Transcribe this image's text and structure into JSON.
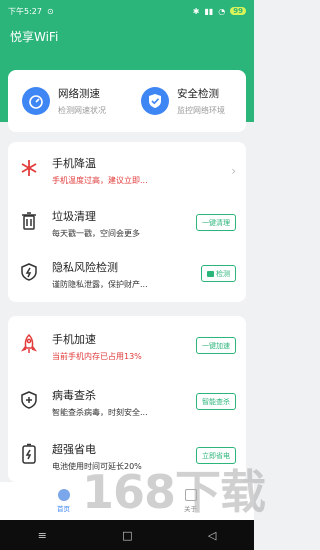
{
  "status_bar": {
    "time": "下午5:27",
    "battery": "99"
  },
  "app": {
    "title": "悦享WiFi"
  },
  "quick_actions": [
    {
      "title": "网络测速",
      "subtitle": "检测网速状况",
      "icon": "speedometer-icon"
    },
    {
      "title": "安全检测",
      "subtitle": "监控网络环境",
      "icon": "shield-check-icon"
    }
  ],
  "tools_a": [
    {
      "title": "手机降温",
      "subtitle": "手机温度过高，建议立即...",
      "icon": "snowflake-icon",
      "action": ""
    },
    {
      "title": "垃圾清理",
      "subtitle": "每天戳一戳，空间会更多",
      "icon": "trash-icon",
      "action": "一键清理"
    },
    {
      "title": "隐私风险检测",
      "subtitle": "谨防隐私泄露，保护财产...",
      "icon": "shield-lightning-icon",
      "action": "检测"
    }
  ],
  "tools_b": [
    {
      "title": "手机加速",
      "subtitle": "当前手机内存已占用13%",
      "icon": "rocket-icon",
      "action": "一键加速"
    },
    {
      "title": "病毒查杀",
      "subtitle": "智能查杀病毒，时刻安全...",
      "icon": "shield-plus-icon",
      "action": "智能查杀"
    },
    {
      "title": "超强省电",
      "subtitle": "电池使用时间可延长20%",
      "icon": "battery-icon",
      "action": "立即省电"
    }
  ],
  "bottom_nav": [
    {
      "label": "首页",
      "icon": "home-icon"
    },
    {
      "label": "关于",
      "icon": "about-icon"
    }
  ],
  "watermark": "168下载",
  "colors": {
    "brand": "#2bb57a",
    "accent": "#3f86f5",
    "warning": "#e23b3b"
  }
}
